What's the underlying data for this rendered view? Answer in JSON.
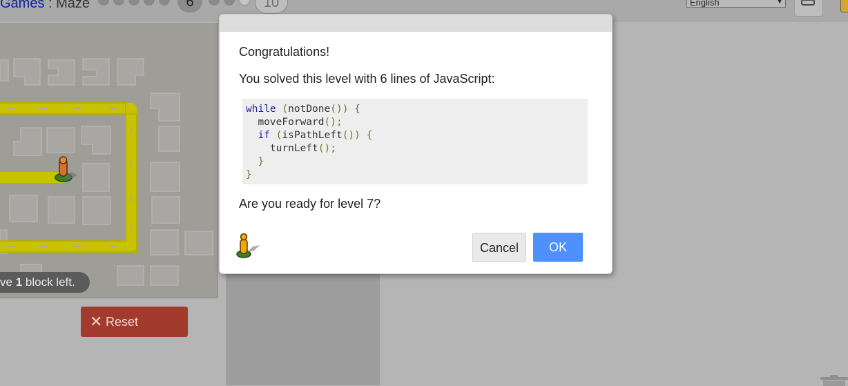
{
  "header": {
    "breadcrumb_link": "Games",
    "breadcrumb_sep": " : ",
    "breadcrumb_current": "Maze",
    "current_level": "6",
    "last_level": "10",
    "language": "English"
  },
  "maze": {
    "status_prefix": "ve ",
    "status_count": "1",
    "status_suffix": " block left."
  },
  "reset_button": {
    "icon": "x-icon",
    "label": "Reset"
  },
  "dialog": {
    "congrats": "Congratulations!",
    "solved": "You solved this level with 6 lines of JavaScript:",
    "code": [
      [
        {
          "t": "while",
          "c": "kw"
        },
        {
          "t": " (",
          "c": "pn"
        },
        {
          "t": "notDone",
          "c": "id"
        },
        {
          "t": "()) {",
          "c": "pn"
        }
      ],
      [
        {
          "t": "  moveForward",
          "c": "id"
        },
        {
          "t": "();",
          "c": "pn"
        }
      ],
      [
        {
          "t": "  if",
          "c": "kw"
        },
        {
          "t": " (",
          "c": "pn"
        },
        {
          "t": "isPathLeft",
          "c": "id"
        },
        {
          "t": "()) {",
          "c": "pn"
        }
      ],
      [
        {
          "t": "    turnLeft",
          "c": "id"
        },
        {
          "t": "();",
          "c": "pn"
        }
      ],
      [
        {
          "t": "  }",
          "c": "pn"
        }
      ],
      [
        {
          "t": "}",
          "c": "pn"
        }
      ]
    ],
    "ready": "Are you ready for level 7?",
    "cancel_label": "Cancel",
    "ok_label": "OK"
  },
  "colors": {
    "ok_button": "#4d90fe",
    "reset_button": "#a23b2e",
    "path_yellow": "#c9c200",
    "keyword": "#1f1fa8"
  }
}
